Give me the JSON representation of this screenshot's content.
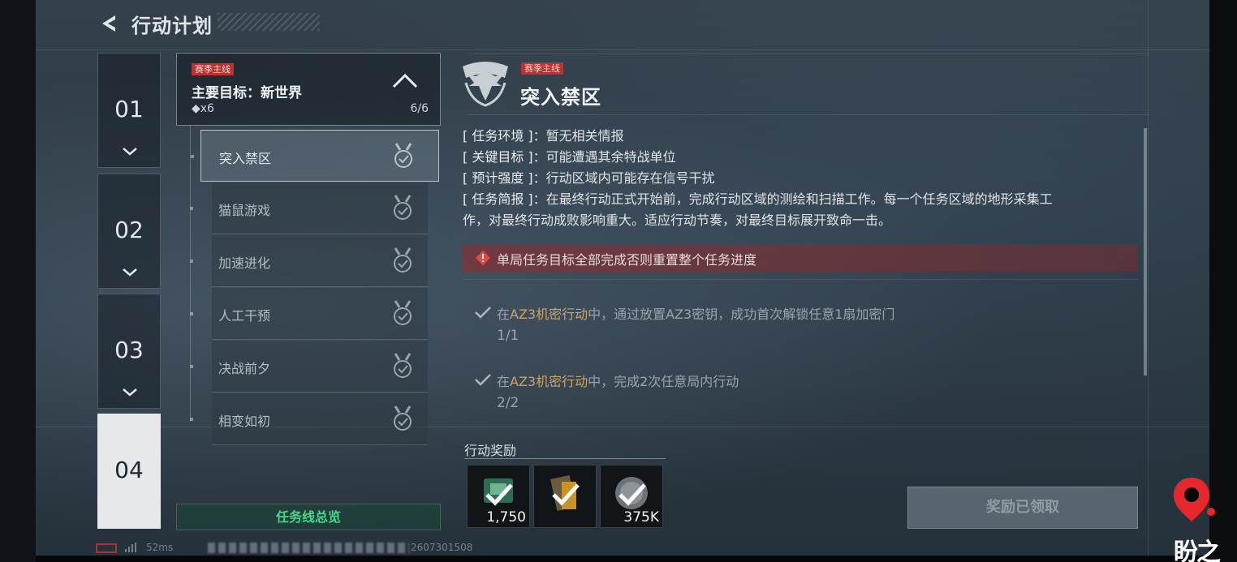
{
  "header": {
    "title": "行动计划",
    "back_icon": "back-arrow-icon"
  },
  "chapters": [
    {
      "label": "01",
      "active": false
    },
    {
      "label": "02",
      "active": false
    },
    {
      "label": "03",
      "active": false
    },
    {
      "label": "04",
      "active": true
    }
  ],
  "mission_group": {
    "tag": "赛季主线",
    "title": "主要目标：新世界",
    "count": "◆x6",
    "progress": "6/6"
  },
  "sub_missions": [
    {
      "label": "突入禁区",
      "selected": true,
      "completed": true
    },
    {
      "label": "猫鼠游戏",
      "selected": false,
      "completed": true
    },
    {
      "label": "加速进化",
      "selected": false,
      "completed": true
    },
    {
      "label": "人工干预",
      "selected": false,
      "completed": true
    },
    {
      "label": "决战前夕",
      "selected": false,
      "completed": true
    },
    {
      "label": "相变如初",
      "selected": false,
      "completed": true
    }
  ],
  "overview_button": "任务线总览",
  "status_bar": {
    "ping": "52ms",
    "uid": "2607301508"
  },
  "detail": {
    "tag": "赛季主线",
    "title": "突入禁区",
    "info": [
      {
        "key": "[ 任务环境 ]",
        "value": "：暂无相关情报"
      },
      {
        "key": "[ 关键目标 ]",
        "value": "：可能遭遇其余特战单位"
      },
      {
        "key": "[ 预计强度 ]",
        "value": "：行动区域内可能存在信号干扰"
      },
      {
        "key": "[ 任务简报 ]",
        "value": "：在最终行动正式开始前，完成行动区域的测绘和扫描工作。每一个任务区域的地形采集工"
      }
    ],
    "info_cont": "作，对最终行动成败影响重大。适应行动节奏，对最终目标展开致命一击。",
    "warning": "单局任务目标全部完成否则重置整个任务进度",
    "objectives": [
      {
        "pre": "在",
        "highlight": "AZ3机密行动",
        "post": "中，通过放置AZ3密钥，成功首次解锁任意1扇加密门",
        "progress": "1/1"
      },
      {
        "pre": "在",
        "highlight": "AZ3机密行动",
        "post": "中，完成2次任意局内行动",
        "progress": "2/2"
      }
    ]
  },
  "rewards": {
    "title": "行动奖励",
    "items": [
      {
        "amount": "1,750",
        "icon": "currency-icon"
      },
      {
        "amount": "",
        "icon": "item-box-icon"
      },
      {
        "amount": "375K",
        "icon": "coin-icon"
      }
    ],
    "claim_button": "奖励已领取"
  },
  "watermark": {
    "text": "盼之"
  },
  "colors": {
    "accent_green": "#46d788",
    "tag_red": "#b8322f",
    "highlight_gold": "#c9a56a",
    "watermark_red": "#e6282d"
  }
}
